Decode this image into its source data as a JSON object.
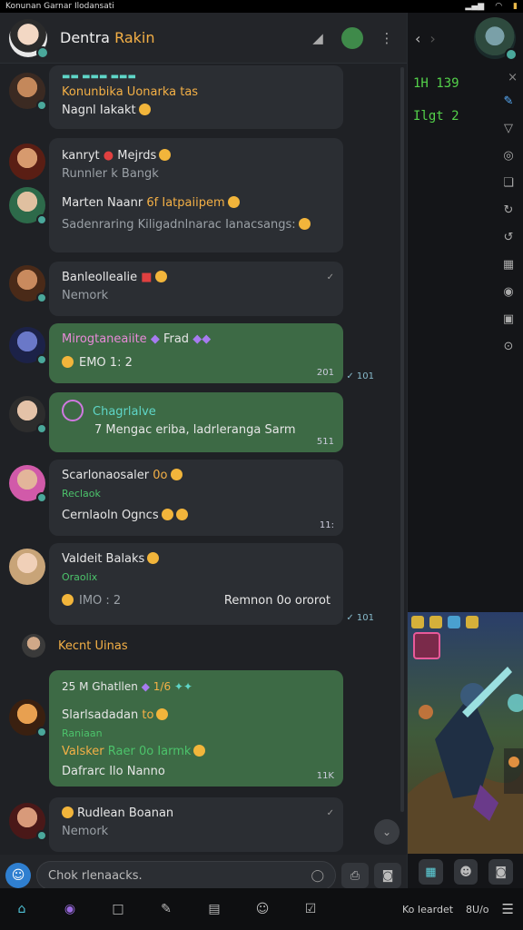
{
  "status_bar": {
    "title": "Konunan Garnar Ilodansati",
    "icons": [
      "signal-icon",
      "wifi-icon",
      "battery-icon"
    ]
  },
  "header": {
    "name_main": "Dentra",
    "name_accent": "Rakin",
    "icons": [
      "mute-icon",
      "avatar-icon",
      "more-vert-icon"
    ]
  },
  "messages": [
    {
      "id": "m1",
      "style": "dark",
      "lines": [
        {
          "text": "Konunbika Uonarka tas",
          "color": "orange"
        },
        {
          "text": "Nagnl Iakakt",
          "color": "white"
        }
      ]
    },
    {
      "id": "m2",
      "style": "dark",
      "lines": [
        {
          "text": "kanryt",
          "color": "white",
          "extra": "Mejrds"
        },
        {
          "text": "Runnler k Bangk",
          "color": "grey"
        },
        {
          "text": "Marten Naanr",
          "color": "white",
          "extra": "6f Iatpaiipem"
        },
        {
          "text": "Sadenraring Kiligadnlnarac Ianacsangs:",
          "color": "grey"
        }
      ]
    },
    {
      "id": "m3",
      "style": "dark",
      "lines": [
        {
          "text": "Banleollealie",
          "color": "white"
        },
        {
          "text": "Nemork",
          "color": "grey"
        }
      ],
      "tick": "✓"
    },
    {
      "id": "m4",
      "style": "green",
      "lines": [
        {
          "text": "Mirogtaneaiite",
          "color": "pink",
          "extra": "Frad"
        },
        {
          "text": "EMO  1:  2",
          "color": "white"
        }
      ],
      "meta": "201",
      "tick": "✓ 101"
    },
    {
      "id": "m5",
      "style": "green",
      "lines": [
        {
          "text": "Chagrlalve",
          "color": "teal"
        },
        {
          "text": "7 Mengac eriba, ladrleranga Sarm",
          "color": "white"
        }
      ],
      "meta": "511"
    },
    {
      "id": "m6",
      "style": "dark",
      "lines": [
        {
          "text": "Scarlonaosaler",
          "color": "white",
          "extra": "0o"
        },
        {
          "text": "Reclaok",
          "color": "greentx"
        },
        {
          "text": "Cernlaoln Ogncs",
          "color": "white"
        }
      ],
      "meta": "11:"
    },
    {
      "id": "m7",
      "style": "dark",
      "lines": [
        {
          "text": "Valdeit Balaks",
          "color": "white"
        },
        {
          "text": "Oraolix",
          "color": "greentx"
        },
        {
          "text": "IMO  :  2",
          "color": "grey",
          "extra": "Remnon 0o ororot"
        }
      ],
      "tick": "✓ 101"
    },
    {
      "id": "m8",
      "style": "green",
      "sender": "Kecnt Uinas",
      "lines": [
        {
          "text": "25  M Ghatllen",
          "color": "white",
          "extra": "1/6"
        },
        {
          "text": "Slarlsadadan",
          "color": "white",
          "extra": "to"
        },
        {
          "text": "Raniaan",
          "color": "greentx"
        },
        {
          "text": "Valsker",
          "color": "orange",
          "extra": "Raer 0o Iarmk"
        },
        {
          "text": "Dafrarc Ilo Nanno",
          "color": "white"
        }
      ],
      "meta": "11K"
    },
    {
      "id": "m9",
      "style": "dark",
      "lines": [
        {
          "text": "Rudlean Boanan",
          "color": "white"
        },
        {
          "text": "Nemork",
          "color": "grey"
        }
      ],
      "tick": "✓"
    }
  ],
  "composer": {
    "placeholder": "Chok rlenaacks.",
    "icons": [
      "emoji-icon",
      "attach-icon",
      "camera-icon"
    ]
  },
  "right_pane": {
    "code_lines": [
      "1H 139",
      "Ilgt 2"
    ],
    "tools": [
      "pen-icon",
      "filter-icon",
      "circle-icon",
      "layers-icon",
      "refresh-icon",
      "undo-icon",
      "calendar-icon",
      "stop-icon",
      "image-icon",
      "chevron-icon"
    ],
    "close_label": "×"
  },
  "bottom_bar": {
    "right_labels": [
      "Ko Ieardet",
      "8U/o"
    ]
  }
}
